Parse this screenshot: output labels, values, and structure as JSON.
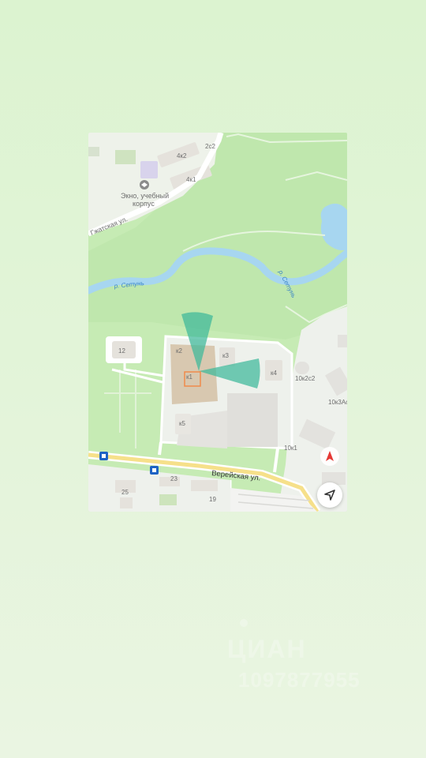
{
  "map": {
    "streets": {
      "gzhatskaya": "Гжатская ул.",
      "vereyskaya": "Верейская ул."
    },
    "river": {
      "label_1": "р. Сетунь",
      "label_2": "р. Сетунь"
    },
    "poi": {
      "school_line1": "Экно, учебный",
      "school_line2": "корпус"
    },
    "buildings": {
      "b_2c2": "2с2",
      "b_4k2": "4к2",
      "b_4k1": "4к1",
      "b_12": "12",
      "b_k2": "к2",
      "b_k3": "к3",
      "b_k1": "к1",
      "b_k4": "к4",
      "b_k5": "к5",
      "b_10k2s2": "10к2с2",
      "b_10k3a": "10к3Ас",
      "b_10k1": "10к1",
      "b_23": "23",
      "b_25": "25",
      "b_19": "19"
    },
    "colors": {
      "park": "#c6ebb4",
      "water": "#a7d6f0",
      "road": "#ffffff",
      "major_road": "#f6e08a",
      "building": "#e9e6e1",
      "highlight_building": "#d8c8b0",
      "view_cone": "#3db99a",
      "selection": "#f08a4b",
      "compass_arrow": "#e53935"
    }
  },
  "controls": {
    "my_location_icon": "navigation-arrow-icon",
    "compass_icon": "compass-icon"
  },
  "watermark": {
    "line1": "ЦИАН",
    "line2": "1097877955"
  }
}
